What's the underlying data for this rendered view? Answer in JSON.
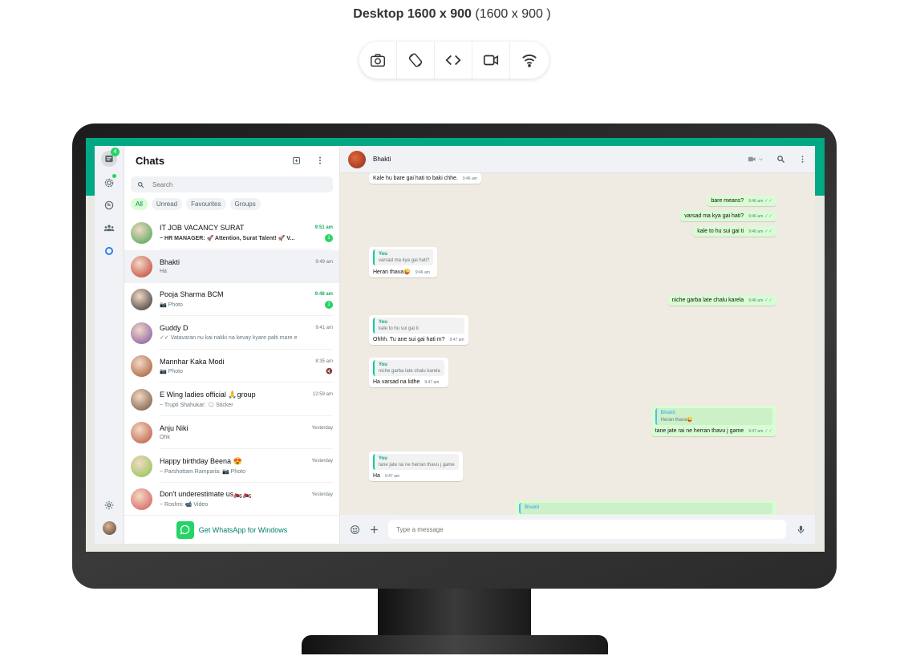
{
  "device": {
    "label": "Desktop 1600 x 900",
    "dims": "(1600 x 900 )"
  },
  "toolbar": {
    "buttons": [
      "camera-icon",
      "rotate-icon",
      "code-icon",
      "video-icon",
      "wifi-icon"
    ]
  },
  "rail": {
    "chats_badge": "4"
  },
  "list": {
    "title": "Chats",
    "search_placeholder": "Search",
    "filters": [
      "All",
      "Unread",
      "Favourites",
      "Groups"
    ],
    "chats": [
      {
        "name": "IT JOB VACANCY SURAT",
        "time": "9:51 am",
        "preview": "~ HR MANAGER: 🚀 Attention, Surat Talent! 🚀 V...",
        "unread": "1",
        "time_green": true,
        "preview_bold": true,
        "avatar_color": "#3fa34d"
      },
      {
        "name": "Bhakti",
        "time": "9:49 am",
        "preview": "Ha",
        "unread": "",
        "avatar_color": "#c0392b"
      },
      {
        "name": "Pooja Sharma BCM",
        "time": "9:48 am",
        "preview": "📷 Photo",
        "unread": "1",
        "time_green": true,
        "avatar_color": "#2c2c2c"
      },
      {
        "name": "Guddy D",
        "time": "9:41 am",
        "preview": "✓✓ Vatavaran nu kai nakki na kevay kyare palti mare e",
        "unread": "",
        "avatar_color": "#7b4fa3"
      },
      {
        "name": "Mannhar Kaka Modi",
        "time": "8:35 am",
        "preview": "📷 Photo",
        "unread": "",
        "muted": true,
        "avatar_color": "#a0522d"
      },
      {
        "name": "E Wing  ladies   official 🙏group",
        "time": "12:59 am",
        "preview": "~ Trupti Shahukar: 🗨 Sticker",
        "unread": "",
        "avatar_color": "#6b4f3a"
      },
      {
        "name": "Anju Niki",
        "time": "Yesterday",
        "preview": "Ohk",
        "unread": "",
        "avatar_color": "#b5523b"
      },
      {
        "name": "Happy birthday Beena 😍",
        "time": "Yesterday",
        "preview": "~ Parshottam Ramparia: 📷 Photo",
        "unread": "",
        "avatar_color": "#8bc34a"
      },
      {
        "name": "Don't underestimate us🏍️🏍️",
        "time": "Yesterday",
        "preview": "~ Roshni: 📹 Video",
        "unread": "",
        "avatar_color": "#d35454"
      }
    ],
    "get_app": "Get WhatsApp for Windows"
  },
  "conversation": {
    "contact_name": "Bhakti",
    "composer_placeholder": "Type a message",
    "messages": [
      {
        "dir": "in",
        "text": "Kale hu bare gai hati to baki chhe.",
        "time": "9:46 am"
      },
      {
        "dir": "out",
        "text": "bare means?",
        "time": "9:46 am"
      },
      {
        "dir": "out",
        "text": "varsad ma kya gai hati?",
        "time": "9:46 am"
      },
      {
        "dir": "out",
        "text": "kale to hu sui gai ti",
        "time": "9:46 am"
      },
      {
        "dir": "in",
        "quote_author": "You",
        "quote_text": "varsad ma kya gai hati?",
        "text": "Heran thava😜",
        "time": "9:46 am"
      },
      {
        "dir": "out",
        "text": "niche garba late chalu karela",
        "time": "9:46 am"
      },
      {
        "dir": "in",
        "quote_author": "You",
        "quote_text": "kale to hu sui gai ti",
        "text": "Ohhh. Tu ane sui gai hati m?",
        "time": "9:47 am"
      },
      {
        "dir": "in",
        "quote_author": "You",
        "quote_text": "niche garba late chalu karela",
        "text": "Ha varsad na lidhe",
        "time": "9:47 am"
      },
      {
        "dir": "out",
        "quote_author": "Bhakti",
        "quote_text": "Heran thava😜",
        "text": "tane jate rai ne herran thavu j game",
        "time": "9:47 am"
      },
      {
        "dir": "in",
        "quote_author": "You",
        "quote_text": "tane jate rai ne herran thavu j game",
        "text": "Ha",
        "time": "9:47 am"
      },
      {
        "dir": "out",
        "quote_author": "Bhakti",
        "quote_text": "",
        "text": "",
        "time": ""
      }
    ]
  },
  "colors": {
    "brand": "#00a884",
    "out_bubble": "#d9fdd3",
    "unread": "#25d366"
  }
}
